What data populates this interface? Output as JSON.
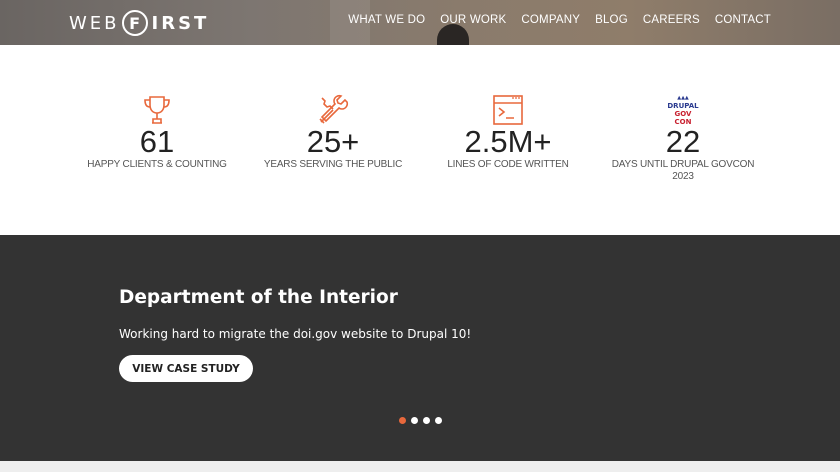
{
  "header": {
    "logo_left": "WEB",
    "logo_mark": "F",
    "logo_right": "IRST",
    "nav": [
      "WHAT WE DO",
      "OUR WORK",
      "COMPANY",
      "BLOG",
      "CAREERS",
      "CONTACT"
    ]
  },
  "stats": [
    {
      "icon": "trophy-icon",
      "value": "61",
      "label": "HAPPY CLIENTS & COUNTING"
    },
    {
      "icon": "tools-icon",
      "value": "25+",
      "label": "YEARS SERVING THE PUBLIC"
    },
    {
      "icon": "code-terminal-icon",
      "value": "2.5M+",
      "label": "LINES OF CODE WRITTEN"
    },
    {
      "icon": "drupal-govcon-icon",
      "value": "22",
      "label": "DAYS UNTIL DRUPAL GOVCON 2023"
    }
  ],
  "drupal_badge": {
    "line1": "DRUPAL",
    "line2": "GOV CON"
  },
  "hero": {
    "title": "Department of the Interior",
    "text": "Working hard to migrate the doi.gov website to Drupal 10!",
    "cta": "VIEW CASE STUDY",
    "slide_count": 4,
    "active_slide": 1
  },
  "colors": {
    "accent": "#e8683c",
    "band": "#333333",
    "header": "#7d7671"
  }
}
